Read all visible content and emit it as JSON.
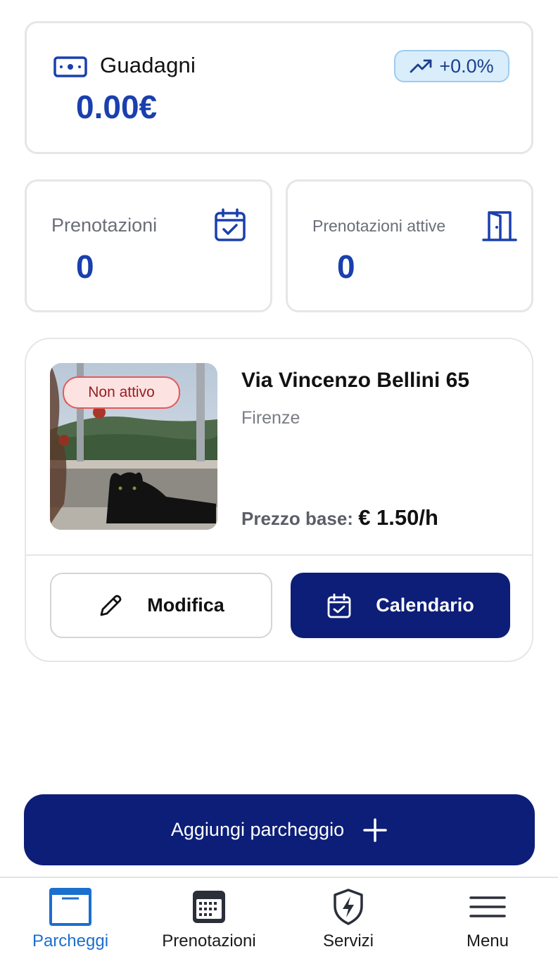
{
  "earnings": {
    "title": "Guadagni",
    "amount": "0.00€",
    "trend": "+0.0%"
  },
  "stats": {
    "bookings": {
      "label": "Prenotazioni",
      "value": "0"
    },
    "active": {
      "label": "Prenotazioni attive",
      "value": "0"
    }
  },
  "parking": {
    "status": "Non attivo",
    "address": "Via Vincenzo Bellini 65",
    "city": "Firenze",
    "price_label": "Prezzo base:",
    "price_value": "€ 1.50/h",
    "edit_label": "Modifica",
    "calendar_label": "Calendario"
  },
  "add_button": {
    "label": "Aggiungi parcheggio"
  },
  "nav": {
    "items": [
      {
        "label": "Parcheggi",
        "icon": "parking-icon",
        "active": true
      },
      {
        "label": "Prenotazioni",
        "icon": "calendar-grid-icon"
      },
      {
        "label": "Servizi",
        "icon": "shield-bolt-icon"
      },
      {
        "label": "Menu",
        "icon": "hamburger-icon"
      }
    ]
  },
  "colors": {
    "primary": "#0d1e78",
    "accent_text": "#1a3fae",
    "nav_active": "#1b6fce",
    "inactive_badge_bg": "#fde2e2",
    "inactive_badge_border": "#e35a5a"
  }
}
